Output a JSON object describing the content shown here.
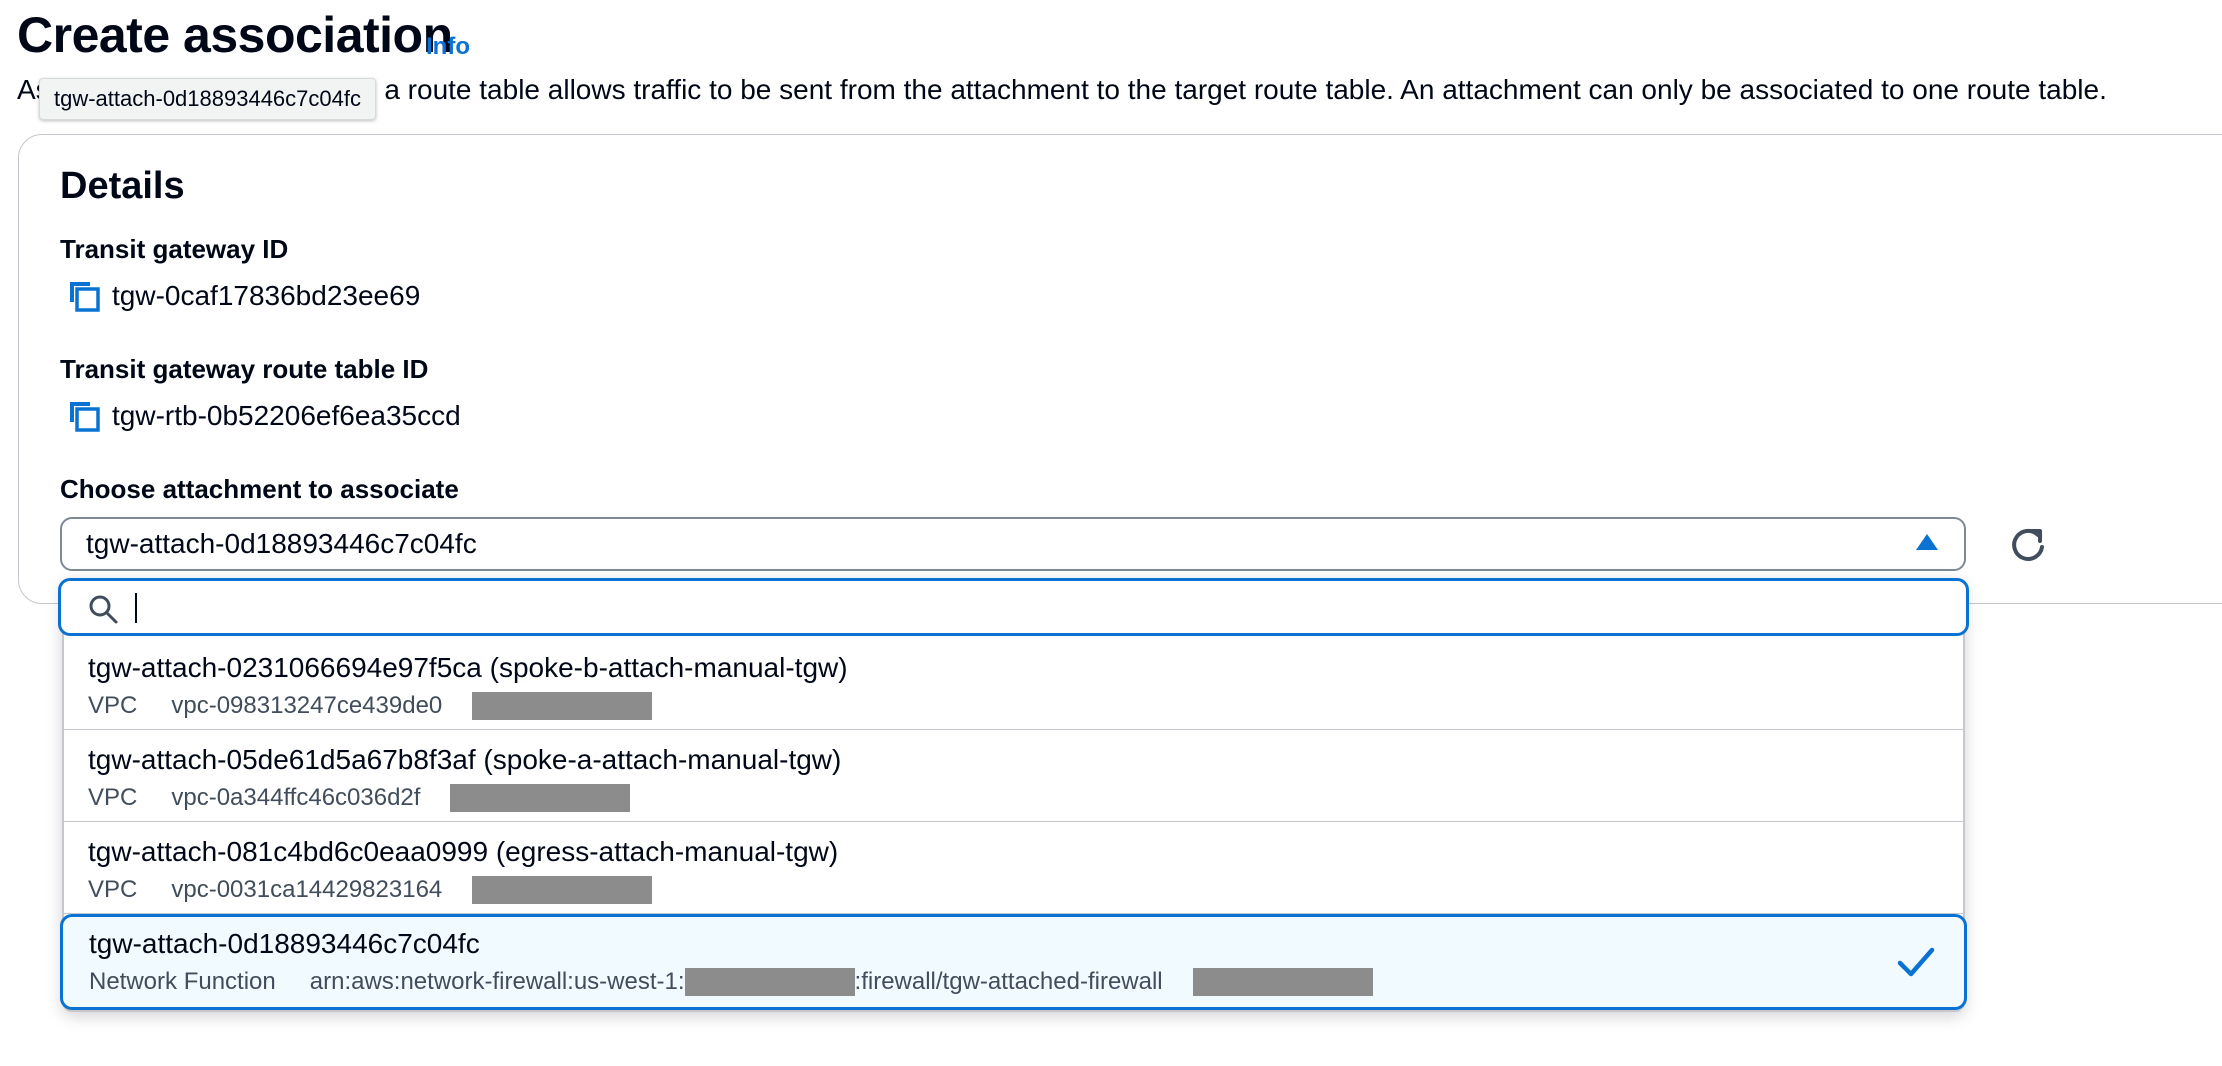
{
  "page": {
    "title": "Create association",
    "info_link": "Info",
    "description": "Associating an attachment to a route table allows traffic to be sent from the attachment to the target route table. An attachment can only be associated to one route table.",
    "tooltip": "tgw-attach-0d18893446c7c04fc"
  },
  "details": {
    "heading": "Details",
    "transit_gateway_id_label": "Transit gateway ID",
    "transit_gateway_id": "tgw-0caf17836bd23ee69",
    "route_table_id_label": "Transit gateway route table ID",
    "route_table_id": "tgw-rtb-0b52206ef6ea35ccd",
    "attachment_label": "Choose attachment to associate",
    "selected_attachment": "tgw-attach-0d18893446c7c04fc"
  },
  "dropdown": {
    "search_placeholder": "",
    "options": [
      {
        "title": "tgw-attach-0231066694e97f5ca (spoke-b-attach-manual-tgw)",
        "type": "VPC",
        "resource": "vpc-098313247ce439de0"
      },
      {
        "title": "tgw-attach-05de61d5a67b8f3af (spoke-a-attach-manual-tgw)",
        "type": "VPC",
        "resource": "vpc-0a344ffc46c036d2f"
      },
      {
        "title": "tgw-attach-081c4bd6c0eaa0999 (egress-attach-manual-tgw)",
        "type": "VPC",
        "resource": "vpc-0031ca14429823164"
      },
      {
        "title": "tgw-attach-0d18893446c7c04fc",
        "type": "Network Function",
        "resource_prefix": "arn:aws:network-firewall:us-west-1:",
        "resource_suffix": ":firewall/tgw-attached-firewall",
        "selected": true
      }
    ]
  },
  "icons": {
    "copy": "copy-icon",
    "refresh": "refresh-icon",
    "search": "search-icon",
    "check": "check-icon",
    "caret": "caret-up-icon"
  },
  "colors": {
    "accent": "#0972d3",
    "text": "#000716",
    "secondary_text": "#414d5c",
    "selected_bg": "#f1faff",
    "redaction": "#8c8c8c"
  }
}
